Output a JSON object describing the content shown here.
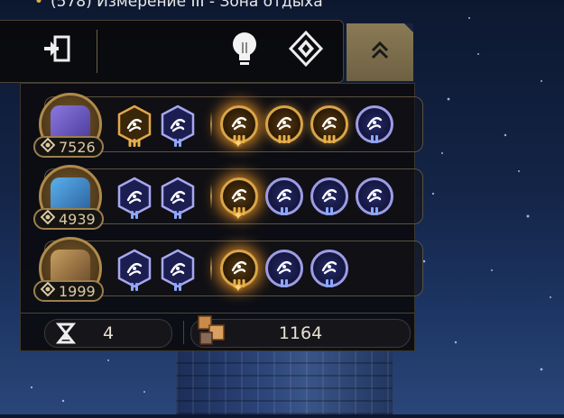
{
  "location": {
    "text": "(578) Измерение III - Зона отдыха"
  },
  "toolbar": {
    "exit_icon": "exit-door-icon",
    "hint_icon": "lightbulb-icon",
    "nav_icon": "diamond-emblem-icon",
    "collapse_icon": "double-chevron-up-icon"
  },
  "teams": [
    {
      "score": "7526",
      "portrait_color": "#6a58c8",
      "left_abilities": [
        {
          "color": "gold",
          "icon": "sparkle-burst-icon"
        },
        {
          "color": "blue",
          "icon": "slash-swirl-icon"
        }
      ],
      "right_abilities": [
        {
          "color": "gold",
          "glow": true,
          "icon": "vortex-icon"
        },
        {
          "color": "gold",
          "icon": "claw-strike-icon"
        },
        {
          "color": "gold",
          "icon": "chalice-icon"
        },
        {
          "color": "blue",
          "icon": "shatter-icon"
        }
      ]
    },
    {
      "score": "4939",
      "portrait_color": "#3f8ad0",
      "left_abilities": [
        {
          "color": "blue",
          "icon": "droplet-icon"
        },
        {
          "color": "blue",
          "icon": "swirl-plus-icon"
        }
      ],
      "right_abilities": [
        {
          "color": "gold",
          "glow": true,
          "icon": "vortex-icon"
        },
        {
          "color": "blue",
          "icon": "square-link-icon"
        },
        {
          "color": "blue",
          "icon": "crossed-swords-icon"
        },
        {
          "color": "blue",
          "icon": "spiral-icon"
        }
      ]
    },
    {
      "score": "1999",
      "portrait_color": "#8a6a3a",
      "left_abilities": [
        {
          "color": "blue",
          "icon": "medical-cross-icon"
        },
        {
          "color": "blue",
          "icon": "vial-icon"
        }
      ],
      "right_abilities": [
        {
          "color": "gold",
          "glow": true,
          "icon": "whirl-icon"
        },
        {
          "color": "blue",
          "icon": "cloud-swirl-icon"
        },
        {
          "color": "blue",
          "icon": "q-rune-icon"
        }
      ]
    }
  ],
  "resources": {
    "hourglass_icon": "hourglass-icon",
    "turns": "4",
    "cube_icon": "cubes-icon",
    "currency": "1164"
  },
  "colors": {
    "gold": "#d9a548",
    "blue": "#9c9ce6",
    "panel": "#0c0c10"
  }
}
